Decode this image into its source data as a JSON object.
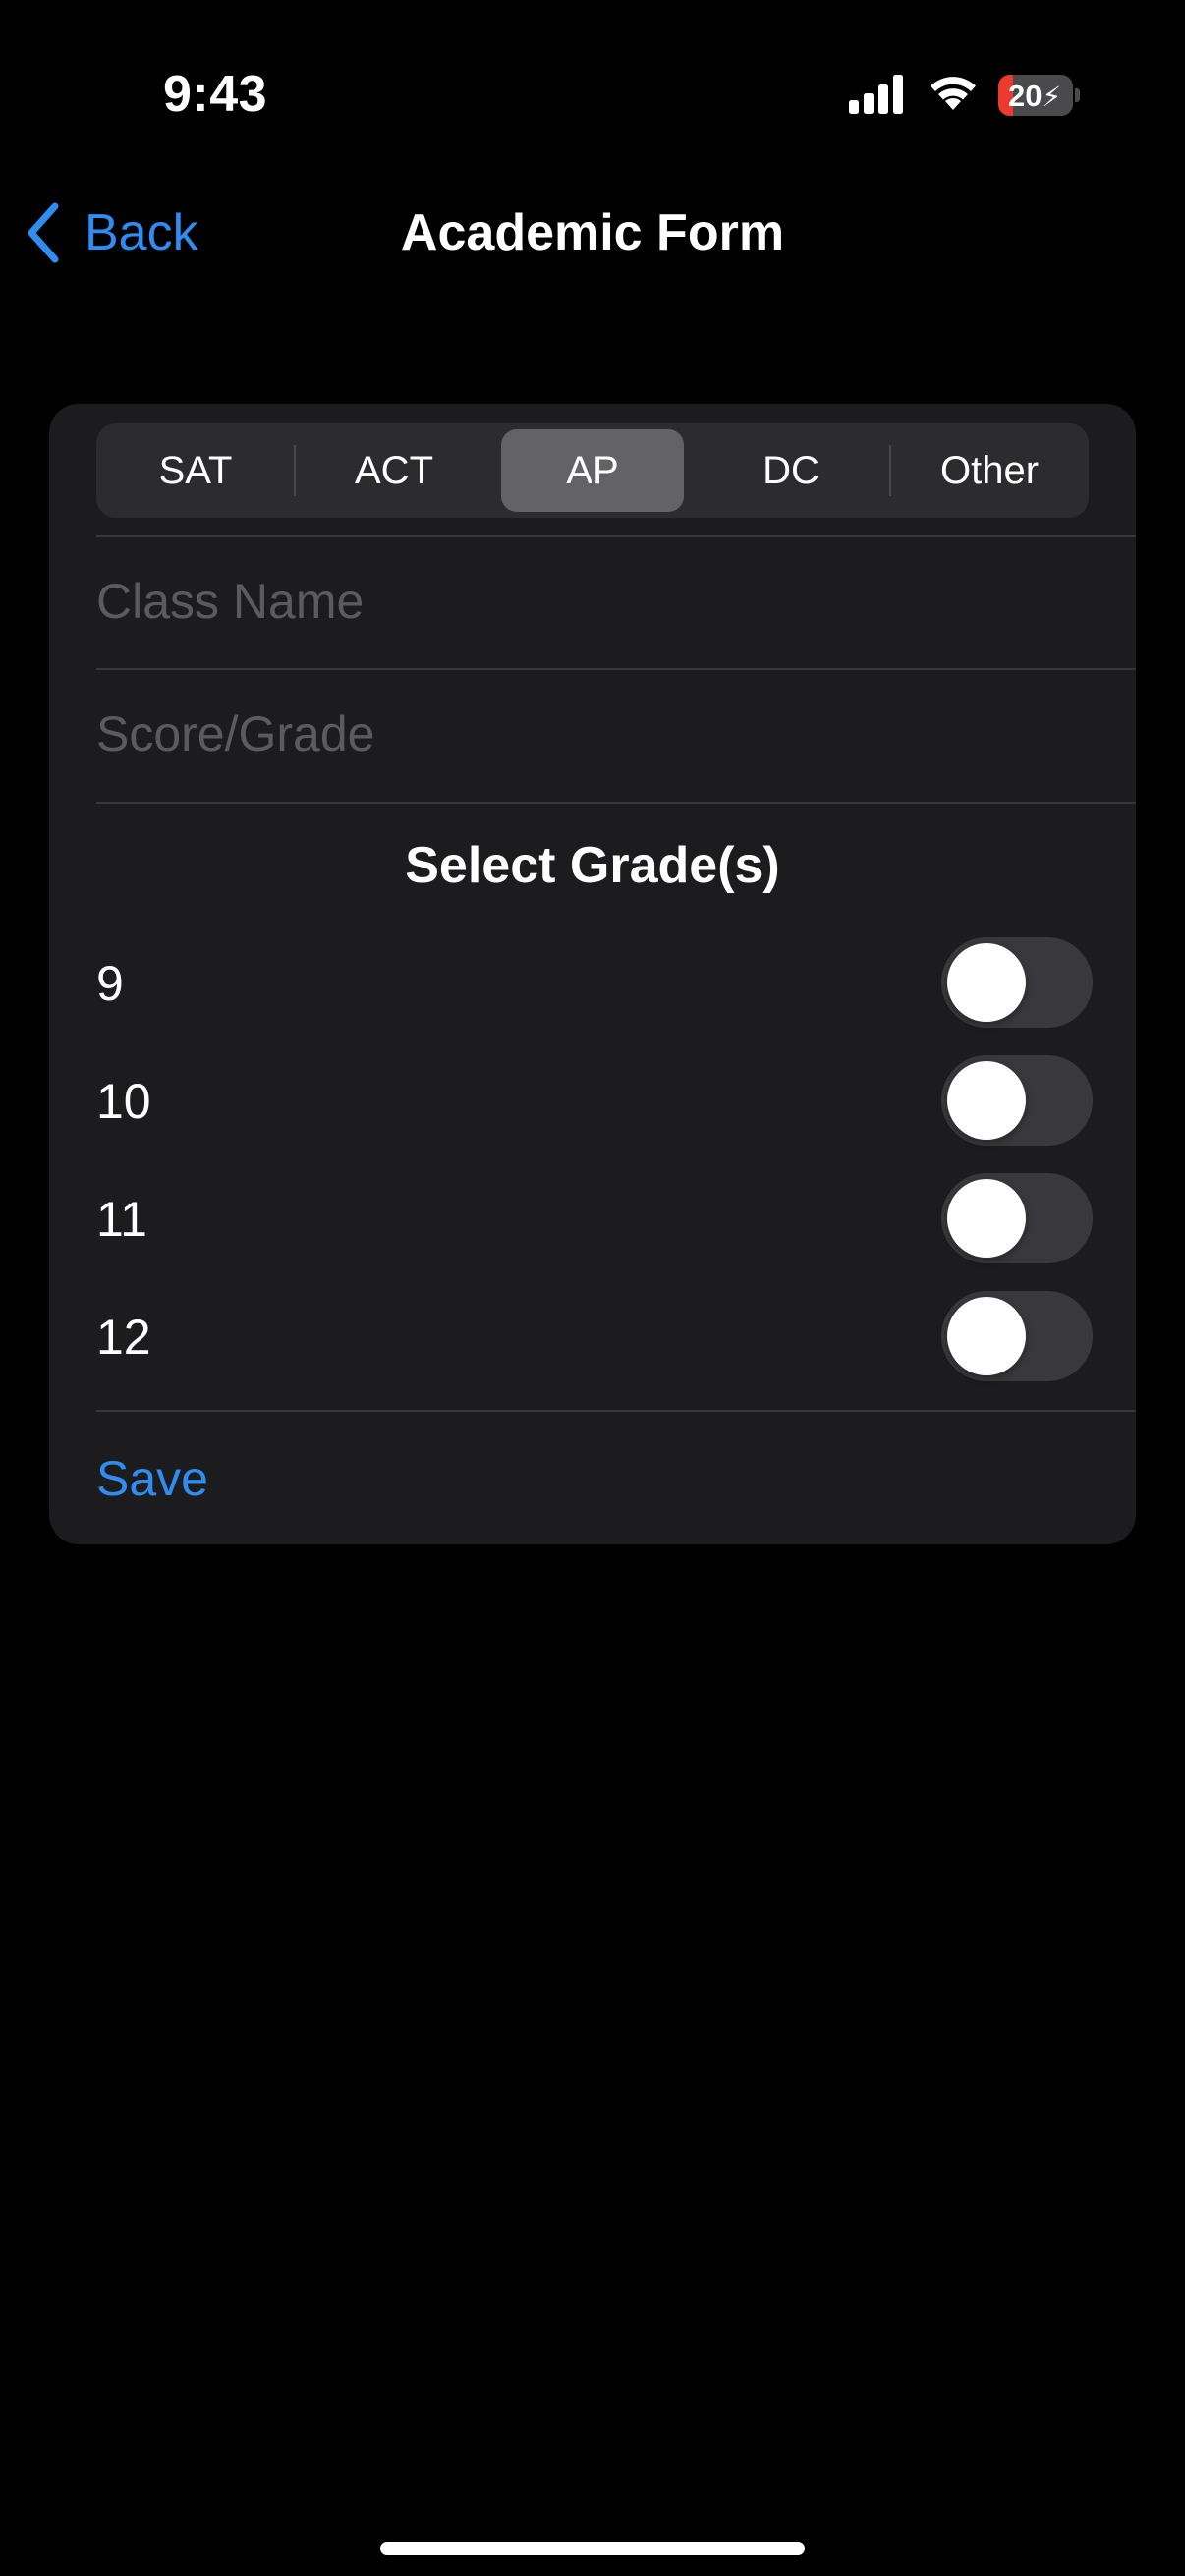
{
  "status_bar": {
    "time": "9:43",
    "battery_level": "20",
    "battery_charging": true,
    "signal_icon": "cellular-signal-icon",
    "wifi_icon": "wifi-icon",
    "battery_icon": "battery-charging-icon"
  },
  "nav": {
    "back_label": "Back",
    "back_icon": "chevron-left-icon",
    "title": "Academic Form"
  },
  "segments": {
    "items": [
      "SAT",
      "ACT",
      "AP",
      "DC",
      "Other"
    ],
    "selected": "AP"
  },
  "fields": {
    "class_name": {
      "placeholder": "Class Name",
      "value": ""
    },
    "score": {
      "placeholder": "Score/Grade",
      "value": ""
    }
  },
  "grades": {
    "title": "Select Grade(s)",
    "items": [
      {
        "label": "9",
        "on": false
      },
      {
        "label": "10",
        "on": false
      },
      {
        "label": "11",
        "on": false
      },
      {
        "label": "12",
        "on": false
      }
    ]
  },
  "save_label": "Save",
  "colors": {
    "background": "#000000",
    "card": "#1c1c1e",
    "accent": "#2f8cf0",
    "segment_selected": "#636366",
    "toggle_off": "#39393d",
    "battery_low": "#eb3b30"
  }
}
